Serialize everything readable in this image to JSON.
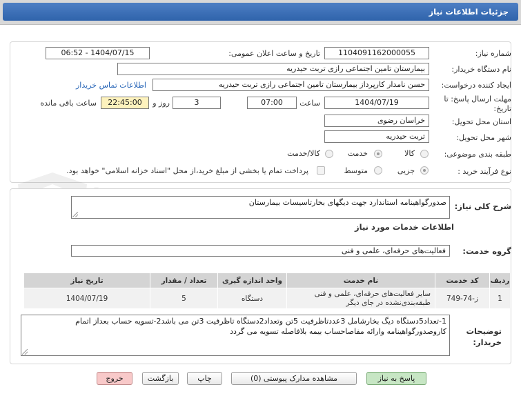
{
  "header": {
    "title": "جزئیات اطلاعات نیاز"
  },
  "form": {
    "need_number": {
      "label": "شماره نیاز:",
      "value": "1104091162000055"
    },
    "announce": {
      "label": "تاریخ و ساعت اعلان عمومی:",
      "value": "1404/07/15 - 06:52"
    },
    "buyer": {
      "label": "نام دستگاه خریدار:",
      "value": "بیمارستان تامین اجتماعی رازی تربت حیدریه"
    },
    "creator": {
      "label": "ایجاد کننده درخواست:",
      "value": "حسن نامدار کارپرداز بیمارستان تامین اجتماعی رازی تربت حیدریه",
      "contact_link": "اطلاعات تماس خریدار"
    },
    "deadline": {
      "label": "مهلت ارسال پاسخ: تا تاریخ:",
      "date": "1404/07/19",
      "time_label": "ساعت",
      "time": "07:00",
      "days": "3",
      "days_label": "روز و",
      "remaining": "22:45:00",
      "remaining_label": "ساعت باقی مانده"
    },
    "province": {
      "label": "استان محل تحویل:",
      "value": "خراسان رضوی"
    },
    "city": {
      "label": "شهر محل تحویل:",
      "value": "تربت حیدریه"
    },
    "category": {
      "label": "طبقه بندی موضوعی:",
      "options": [
        "کالا",
        "خدمت",
        "کالا/خدمت"
      ],
      "selected": "خدمت"
    },
    "purchase_type": {
      "label": "نوع فرآیند خرید :",
      "options": [
        "جزیی",
        "متوسط"
      ],
      "selected": "جزیی",
      "note": "پرداخت تمام یا بخشی از مبلغ خرید،از محل \"اسناد خزانه اسلامی\" خواهد بود."
    }
  },
  "summary": {
    "label": "شرح کلی نیاز:",
    "value": "صدورگواهینامه استاندارد جهت دیگهای بخارتاسیسات بیمارستان"
  },
  "services": {
    "section_title": "اطلاعات خدمات مورد نیاز",
    "group_label": "گروه خدمت:",
    "group_value": "فعالیت‌های حرفه‌ای، علمی و فنی",
    "table": {
      "headers": [
        "ردیف",
        "کد خدمت",
        "نام خدمت",
        "واحد اندازه گیری",
        "تعداد / مقدار",
        "تاریخ نیاز"
      ],
      "rows": [
        {
          "index": "1",
          "code": "ز-74-749",
          "name": "سایر فعالیت‌های حرفه‌ای، علمی و فنی طبقه‌بندی‌نشده در جای دیگر",
          "unit": "دستگاه",
          "qty": "5",
          "date": "1404/07/19"
        }
      ]
    }
  },
  "notes": {
    "label": "توضیحات خریدار:",
    "value": "1-تعداد5دستگاه دیگ بخارشامل 3عددتاظرفیت 5تن وتعداد2دستگاه تاظرفیت 3تن می باشد2-تسویه حساب بعداز اتمام کاروصدورگواهینامه وارائه مفاصاحساب بیمه بلافاصله تسویه می گردد"
  },
  "buttons": {
    "reply": "پاسخ به نیاز",
    "attachments": "مشاهده مدارک پیوستی (0)",
    "print": "چاپ",
    "back": "بازگشت",
    "exit": "خروج"
  },
  "watermark": {
    "text": "AriaTender.net"
  },
  "colors": {
    "header": "#3a6db5",
    "link": "#2463b6",
    "time_highlight": "#fdf2bd",
    "exit_button": "#f8c9c9",
    "reply_button": "#c7e6c4"
  }
}
